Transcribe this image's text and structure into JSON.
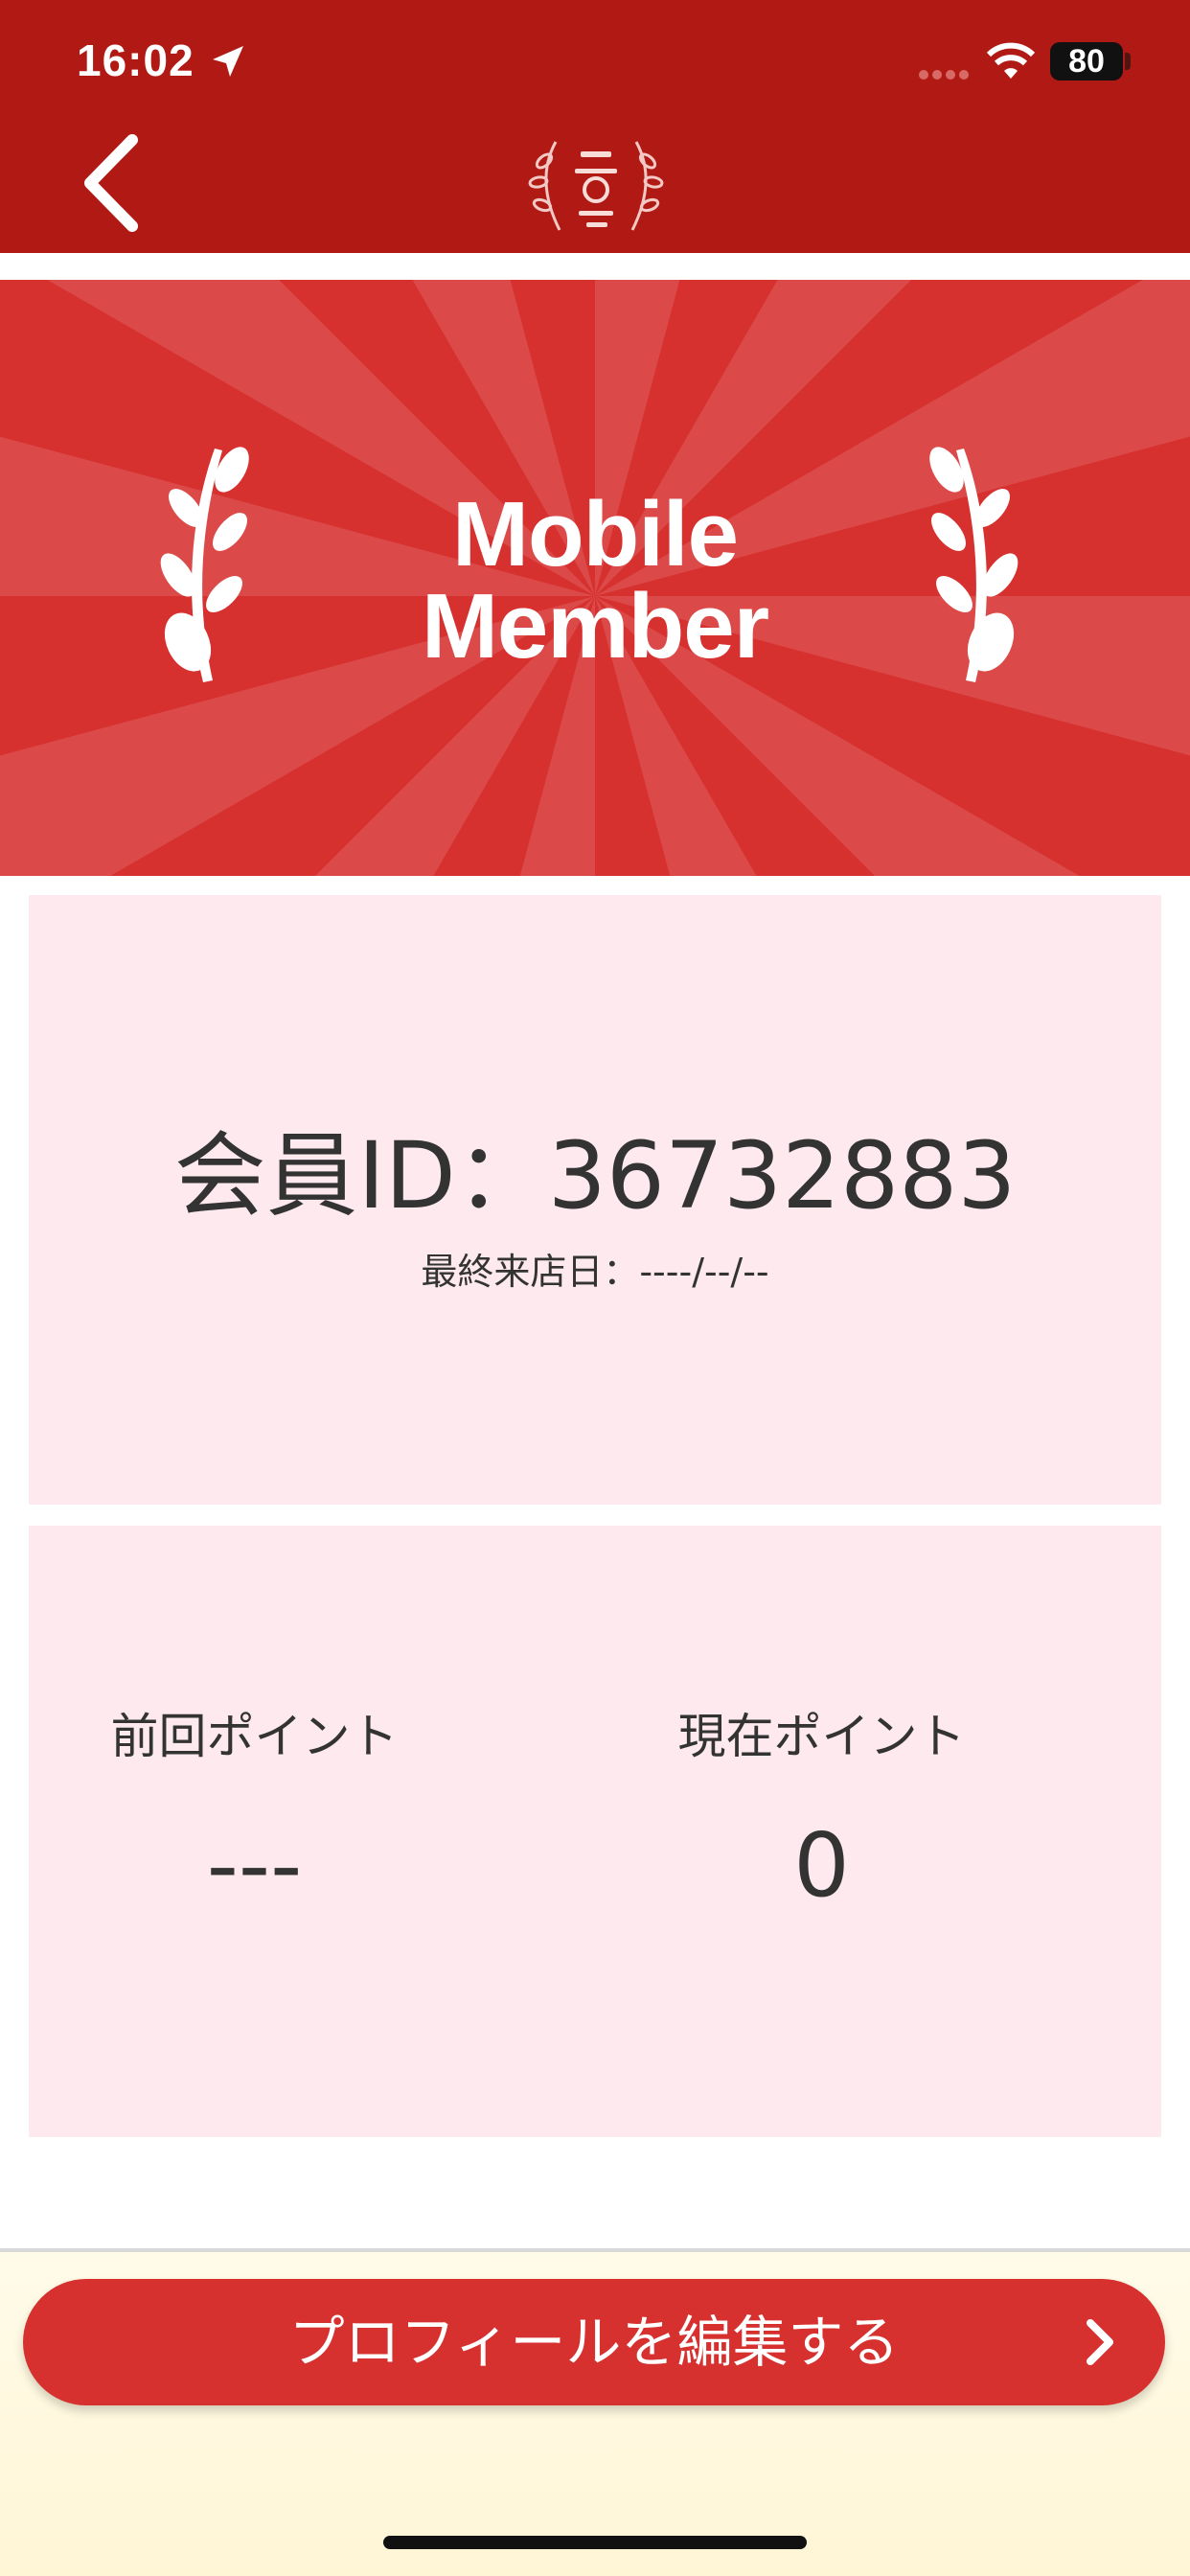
{
  "status_bar": {
    "time": "16:02",
    "battery": "80",
    "icons": [
      "location-arrow-icon",
      "signal-icon",
      "wifi-icon",
      "battery-icon"
    ]
  },
  "header": {
    "logo_icon": "laurel-rice-logo",
    "back_icon": "chevron-left-icon",
    "background": "#b11a14"
  },
  "banner": {
    "line1": "Mobile",
    "line2": "Member",
    "background": "#d6302f",
    "icons": [
      "laurel-left-icon",
      "laurel-right-icon"
    ]
  },
  "member": {
    "id_text": "会員ID：36732883",
    "last_visit": "最終来店日：----/--/--"
  },
  "points": {
    "previous_label": "前回ポイント",
    "previous_value": "---",
    "current_label": "現在ポイント",
    "current_value": "0"
  },
  "actions": {
    "edit_profile_label": "プロフィールを編集する",
    "button_color": "#d6302f"
  },
  "colors": {
    "card_background": "#fde9ee",
    "text": "#333333"
  }
}
